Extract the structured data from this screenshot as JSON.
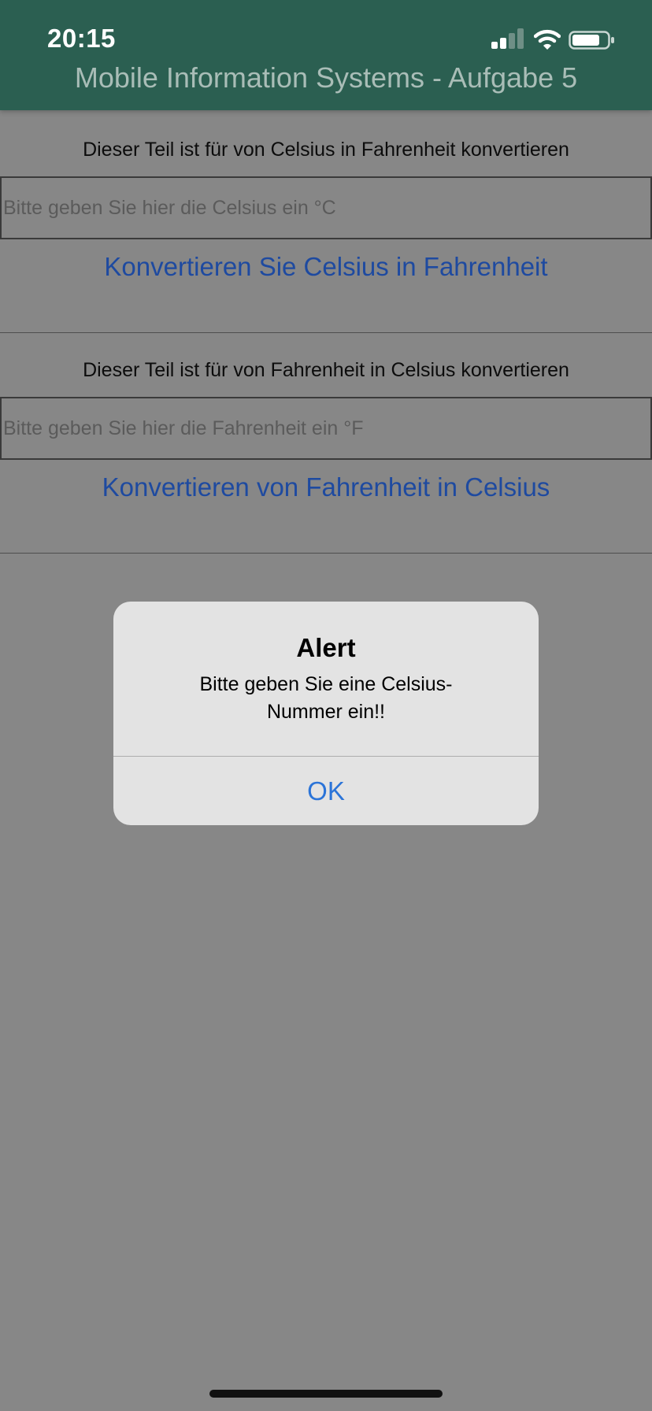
{
  "status_bar": {
    "time": "20:15",
    "icons": [
      "cellular-signal-icon",
      "wifi-icon",
      "battery-icon"
    ]
  },
  "header": {
    "title": "Mobile Information Systems - Aufgabe 5",
    "background_color": "#2b5f51"
  },
  "celsius_section": {
    "caption": "Dieser Teil ist für von Celsius in Fahrenheit konvertieren",
    "input_value": "",
    "input_placeholder": "Bitte geben Sie hier die Celsius ein °C",
    "button_label": "Konvertieren Sie Celsius in Fahrenheit"
  },
  "fahrenheit_section": {
    "caption": "Dieser Teil ist für von Fahrenheit in Celsius konvertieren",
    "input_value": "",
    "input_placeholder": "Bitte geben Sie hier die Fahrenheit ein °F",
    "button_label": "Konvertieren von Fahrenheit in Celsius"
  },
  "alert": {
    "title": "Alert",
    "message": "Bitte geben Sie eine Celsius-Nummer ein!!",
    "ok_label": "OK",
    "ok_color": "#2b74d8"
  },
  "colors": {
    "link_color": "#1e4aa0",
    "dimmed_background": "#878787"
  }
}
